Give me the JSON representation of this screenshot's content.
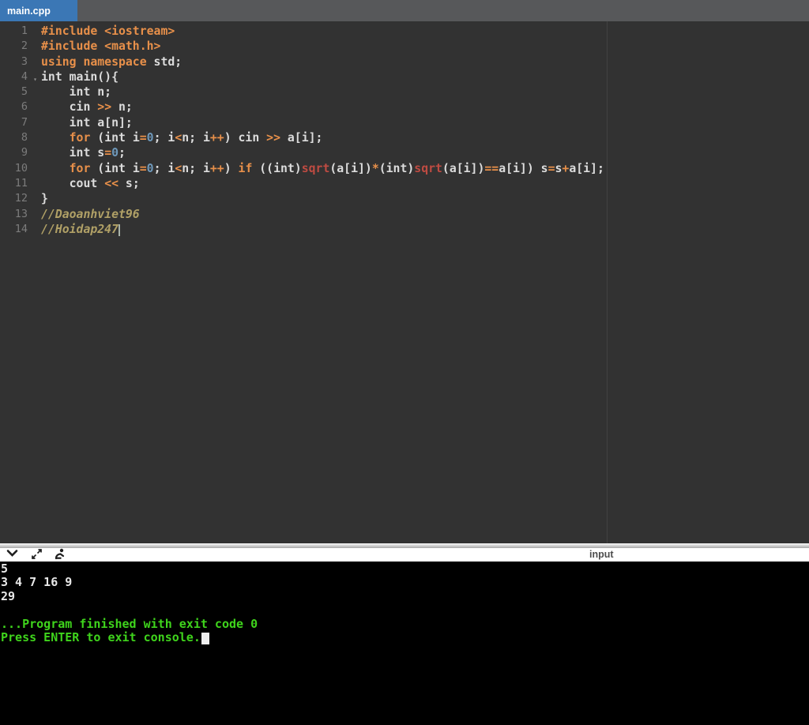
{
  "tabbar": {
    "active_tab": "main.cpp"
  },
  "colors": {
    "tab_active_bg": "#3b77b5",
    "tabbar_bg": "#57585a",
    "editor_bg": "#323232",
    "keyword": "#e8904a",
    "number": "#6f99bb",
    "function": "#bf4b42",
    "comment": "#b0a066",
    "plain": "#dcdcdc",
    "console_green": "#3fd41c",
    "console_white": "#e8e8e8"
  },
  "editor": {
    "fold_marker_glyph": "▾",
    "lines": [
      {
        "n": 1,
        "tokens": [
          [
            "kw",
            "#include <iostream>"
          ]
        ]
      },
      {
        "n": 2,
        "tokens": [
          [
            "kw",
            "#include <math.h>"
          ]
        ]
      },
      {
        "n": 3,
        "tokens": [
          [
            "kw",
            "using namespace "
          ],
          [
            "pl",
            "std;"
          ]
        ]
      },
      {
        "n": 4,
        "fold": true,
        "tokens": [
          [
            "pl",
            "int main(){"
          ]
        ]
      },
      {
        "n": 5,
        "tokens": [
          [
            "pl",
            "    int n;"
          ]
        ]
      },
      {
        "n": 6,
        "tokens": [
          [
            "pl",
            "    cin "
          ],
          [
            "kw",
            ">>"
          ],
          [
            "pl",
            " n;"
          ]
        ]
      },
      {
        "n": 7,
        "tokens": [
          [
            "pl",
            "    int a[n];"
          ]
        ]
      },
      {
        "n": 8,
        "tokens": [
          [
            "pl",
            "    "
          ],
          [
            "kw",
            "for"
          ],
          [
            "pl",
            " (int i"
          ],
          [
            "kw",
            "="
          ],
          [
            "num",
            "0"
          ],
          [
            "pl",
            "; i"
          ],
          [
            "kw",
            "<"
          ],
          [
            "pl",
            "n; i"
          ],
          [
            "kw",
            "++"
          ],
          [
            "pl",
            ") cin "
          ],
          [
            "kw",
            ">>"
          ],
          [
            "pl",
            " a[i];"
          ]
        ]
      },
      {
        "n": 9,
        "tokens": [
          [
            "pl",
            "    int s"
          ],
          [
            "kw",
            "="
          ],
          [
            "num",
            "0"
          ],
          [
            "pl",
            ";"
          ]
        ]
      },
      {
        "n": 10,
        "tokens": [
          [
            "pl",
            "    "
          ],
          [
            "kw",
            "for"
          ],
          [
            "pl",
            " (int i"
          ],
          [
            "kw",
            "="
          ],
          [
            "num",
            "0"
          ],
          [
            "pl",
            "; i"
          ],
          [
            "kw",
            "<"
          ],
          [
            "pl",
            "n; i"
          ],
          [
            "kw",
            "++"
          ],
          [
            "pl",
            ") "
          ],
          [
            "kw",
            "if"
          ],
          [
            "pl",
            " ((int)"
          ],
          [
            "fn",
            "sqrt"
          ],
          [
            "pl",
            "(a[i])"
          ],
          [
            "kw",
            "*"
          ],
          [
            "pl",
            "(int)"
          ],
          [
            "fn",
            "sqrt"
          ],
          [
            "pl",
            "(a[i])"
          ],
          [
            "kw",
            "=="
          ],
          [
            "pl",
            "a[i]) s"
          ],
          [
            "kw",
            "="
          ],
          [
            "pl",
            "s"
          ],
          [
            "kw",
            "+"
          ],
          [
            "pl",
            "a[i];"
          ]
        ]
      },
      {
        "n": 11,
        "tokens": [
          [
            "pl",
            "    cout "
          ],
          [
            "kw",
            "<<"
          ],
          [
            "pl",
            " s;"
          ]
        ]
      },
      {
        "n": 12,
        "tokens": [
          [
            "pl",
            "}"
          ]
        ]
      },
      {
        "n": 13,
        "tokens": [
          [
            "com",
            "//Daoanhviet96"
          ]
        ]
      },
      {
        "n": 14,
        "cursor": true,
        "tokens": [
          [
            "com",
            "//Hoidap247"
          ]
        ]
      }
    ]
  },
  "console_toolbar": {
    "icons": [
      "chevron-down-icon",
      "expand-icon",
      "user-typing-icon"
    ],
    "input_label": "input"
  },
  "console": {
    "lines": [
      {
        "text": "5",
        "type": "stdout"
      },
      {
        "text": "3 4 7 16 9",
        "type": "stdout"
      },
      {
        "text": "29",
        "type": "stdout"
      },
      {
        "text": "",
        "type": "stdout"
      },
      {
        "text": "...Program finished with exit code 0",
        "type": "status"
      },
      {
        "text": "Press ENTER to exit console.",
        "type": "status",
        "cursor": true
      }
    ]
  }
}
